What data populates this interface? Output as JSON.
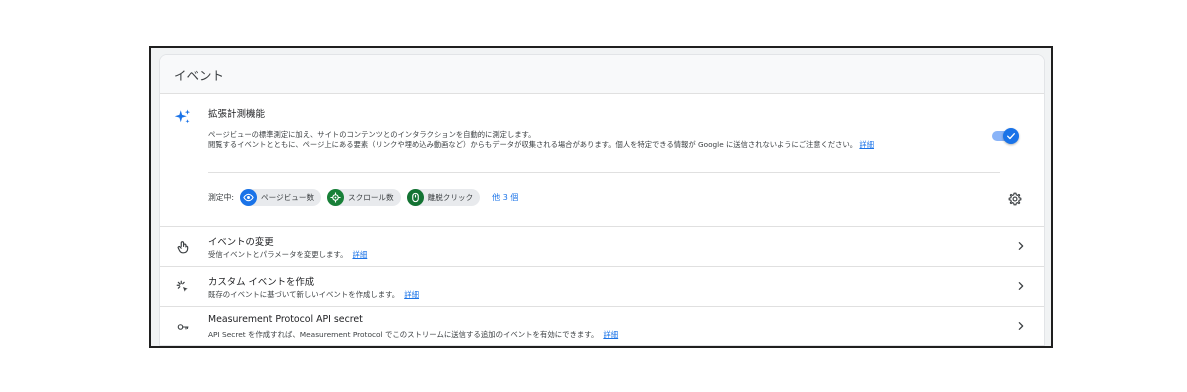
{
  "card": {
    "title": "イベント"
  },
  "enhanced": {
    "title": "拡張計測機能",
    "desc_line1": "ページビューの標準測定に加え、サイトのコンテンツとのインタラクションを自動的に測定します。",
    "desc_line2": "閲覧するイベントとともに、ページ上にある要素（リンクや埋め込み動画など）からもデータが収集される場合があります。個人を特定できる情報が Google に送信されないようにご注意ください。",
    "desc_link": "詳細",
    "toggle_on": true,
    "measuring_label": "測定中:",
    "chips": [
      {
        "label": "ページビュー数",
        "icon": "eye-icon",
        "color": "#1a73e8"
      },
      {
        "label": "スクロール数",
        "icon": "crosshair-icon",
        "color": "#188038"
      },
      {
        "label": "離脱クリック",
        "icon": "mouse-icon",
        "color": "#137333"
      }
    ],
    "more": "他 3 個"
  },
  "rows": [
    {
      "title": "イベントの変更",
      "subtitle": "受信イベントとパラメータを変更します。",
      "link": "詳細",
      "icon": "touch-icon"
    },
    {
      "title": "カスタム イベントを作成",
      "subtitle": "既存のイベントに基づいて新しいイベントを作成します。",
      "link": "詳細",
      "icon": "click-sparkle-icon"
    },
    {
      "title": "Measurement Protocol API secret",
      "subtitle": "API Secret を作成すれば、Measurement Protocol でこのストリームに送信する追加のイベントを有効にできます。",
      "link": "詳細",
      "icon": "key-icon"
    }
  ],
  "colors": {
    "accent": "#1a73e8",
    "toggle_track": "#8ab4f8"
  }
}
